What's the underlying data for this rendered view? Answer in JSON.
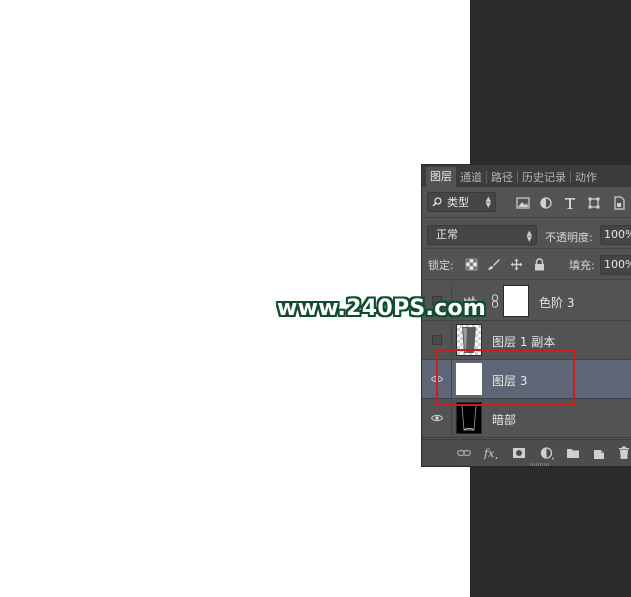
{
  "panel": {
    "tabs": [
      {
        "label": "图层",
        "active": true
      },
      {
        "label": "通道",
        "active": false
      },
      {
        "label": "路径",
        "active": false
      },
      {
        "label": "历史记录",
        "active": false
      },
      {
        "label": "动作",
        "active": false
      }
    ],
    "filter": {
      "kind_label": "类型",
      "filter_icons": [
        "image-filter-icon",
        "adjustment-filter-icon",
        "type-filter-icon",
        "shape-filter-icon",
        "smart-object-filter-icon"
      ]
    },
    "blend": {
      "mode": "正常",
      "opacity_label": "不透明度:",
      "opacity_value": "100%"
    },
    "lock": {
      "label": "锁定:",
      "fill_label": "填充:",
      "fill_value": "100%"
    },
    "layers": [
      {
        "name": "色阶 3",
        "visible": false,
        "type": "adjustment",
        "selected": false
      },
      {
        "name": "图层 1 副本",
        "visible": false,
        "type": "pixel",
        "selected": false
      },
      {
        "name": "图层 3",
        "visible": true,
        "type": "pixel",
        "selected": true
      },
      {
        "name": "暗部",
        "visible": true,
        "type": "pixel",
        "selected": false
      }
    ],
    "selection_color": "#5d6577",
    "highlight_color": "#cc1d1d"
  },
  "watermark": "www.240PS.com"
}
